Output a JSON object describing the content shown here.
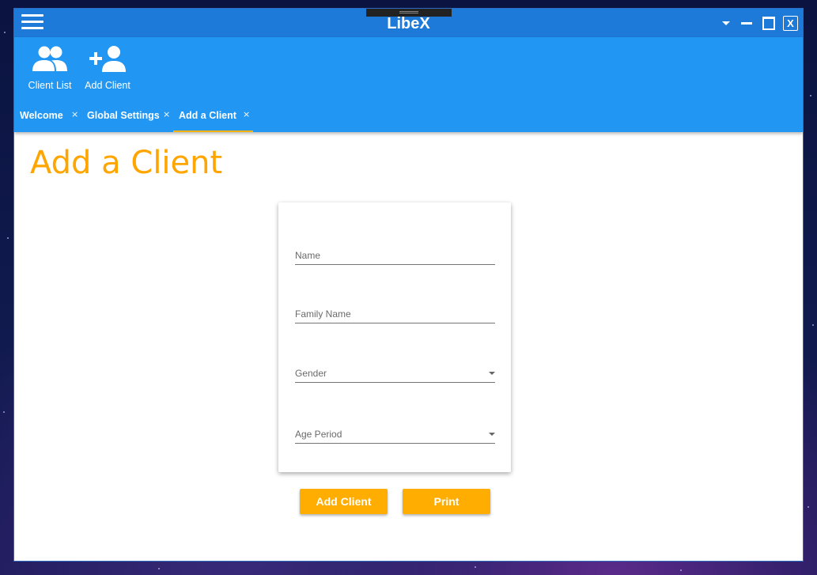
{
  "window": {
    "title": "LibeX",
    "close_label": "X"
  },
  "toolbar": {
    "client_list_label": "Client List",
    "add_client_label": "Add Client"
  },
  "tabs": [
    {
      "label": "Welcome",
      "close": "×"
    },
    {
      "label": "Global Settings",
      "close": "×"
    },
    {
      "label": "Add a Client",
      "close": "×",
      "active": true
    }
  ],
  "page": {
    "title": "Add a Client"
  },
  "form": {
    "name_label": "Name",
    "family_name_label": "Family Name",
    "gender_label": "Gender",
    "age_period_label": "Age Period"
  },
  "actions": {
    "add_client_label": "Add Client",
    "print_label": "Print"
  },
  "colors": {
    "titlebar": "#1e7ad9",
    "toolbar": "#2196f3",
    "accent": "#ffad00"
  }
}
